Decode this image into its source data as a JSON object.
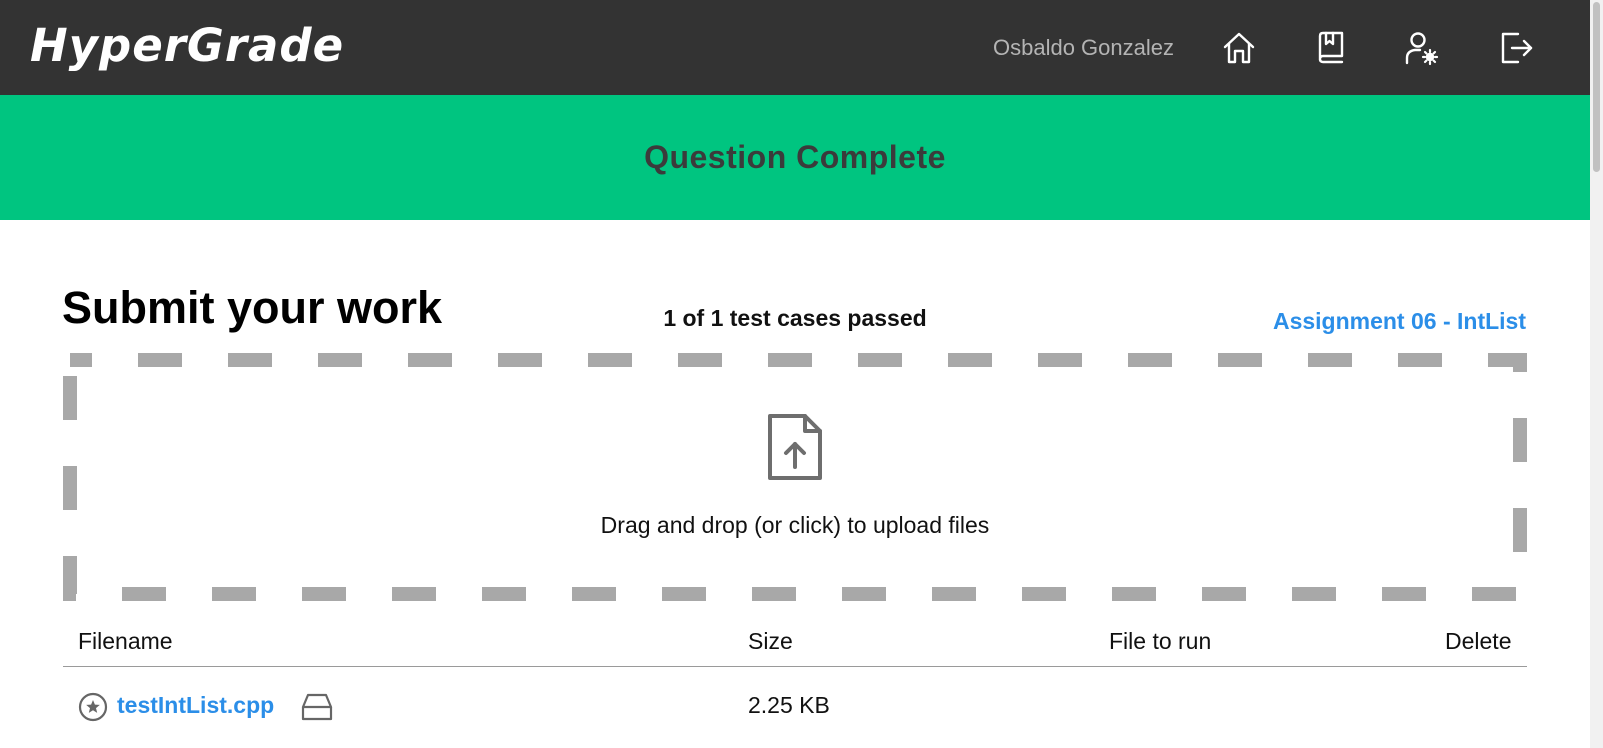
{
  "header": {
    "logo": "HyperGrade",
    "user_name": "Osbaldo Gonzalez",
    "nav_icons": [
      "home-icon",
      "book-icon",
      "user-settings-icon",
      "logout-icon"
    ]
  },
  "banner": {
    "text": "Question Complete",
    "color": "#00c580"
  },
  "main": {
    "title": "Submit your work",
    "test_summary": "1 of 1 test cases passed",
    "assignment_link": "Assignment 06 - IntList",
    "dropzone": {
      "icon": "file-upload-icon",
      "text": "Drag and drop (or click) to upload files"
    },
    "table": {
      "columns": [
        "Filename",
        "Size",
        "File to run",
        "Delete"
      ],
      "rows": [
        {
          "filename": "testIntList.cpp",
          "size": "2.25 KB",
          "icons": [
            "star-circle-icon",
            "drive-icon"
          ]
        }
      ]
    }
  },
  "colors": {
    "topbar": "#333333",
    "accent_link": "#2b8ee8",
    "dashed_border": "#a8a8a8"
  }
}
